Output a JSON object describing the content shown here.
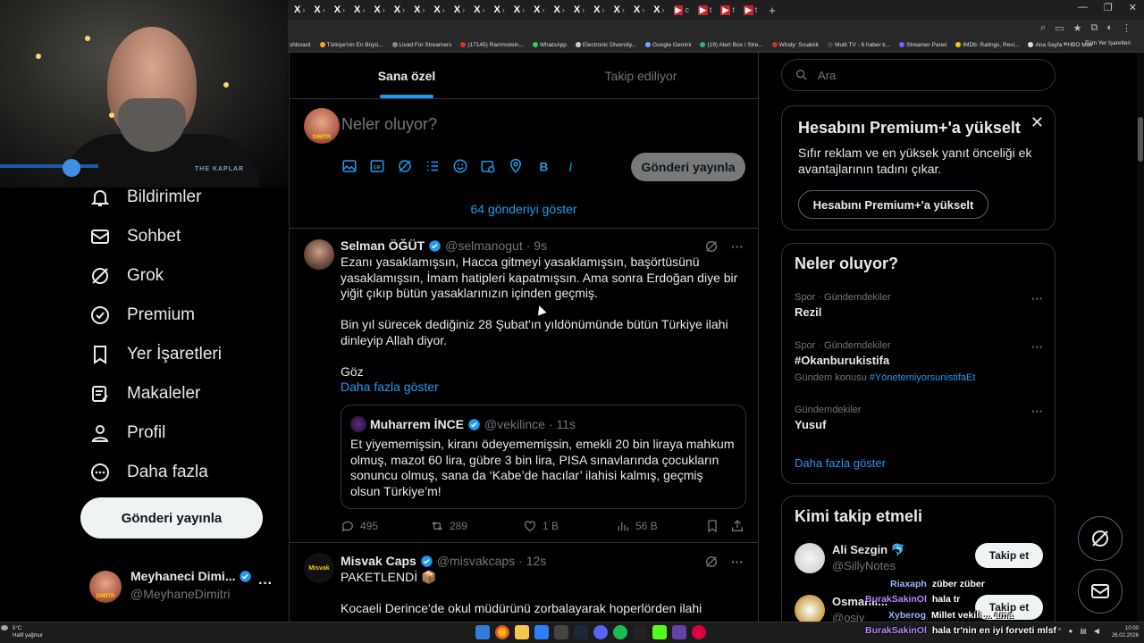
{
  "browser": {
    "tabs": [
      {
        "short": "X",
        "close": "›"
      },
      {
        "short": "X",
        "close": "›"
      },
      {
        "short": "X",
        "close": "›"
      },
      {
        "short": "X",
        "close": "›"
      },
      {
        "short": "X",
        "close": "›"
      },
      {
        "short": "X",
        "close": "›"
      },
      {
        "short": "X",
        "close": "›"
      },
      {
        "short": "X",
        "close": "›"
      },
      {
        "short": "X",
        "close": "›"
      },
      {
        "short": "X",
        "close": "›"
      },
      {
        "short": "X",
        "close": "›"
      },
      {
        "short": "X",
        "close": "›"
      },
      {
        "short": "X",
        "close": "›"
      },
      {
        "short": "X",
        "close": "›"
      },
      {
        "short": "X",
        "close": "›"
      },
      {
        "short": "X",
        "close": "›"
      },
      {
        "short": "X",
        "close": "›"
      },
      {
        "short": "X",
        "close": "›"
      },
      {
        "short": "X",
        "close": "›"
      },
      {
        "short": "▶",
        "close": "c",
        "red": true
      },
      {
        "short": "▶",
        "close": "t",
        "red": true
      },
      {
        "short": "▶",
        "close": "t",
        "red": true
      },
      {
        "short": "▶",
        "close": "t",
        "red": true
      }
    ],
    "new_tab": "+",
    "bookmarks": [
      {
        "label": "shboard",
        "color": ""
      },
      {
        "label": "Türkiye'nin En Büyü...",
        "color": "#f5a623"
      },
      {
        "label": "Livad For Streamers",
        "color": "#888"
      },
      {
        "label": "(17145) Rammstein...",
        "color": "#e52d27"
      },
      {
        "label": "WhatsApp",
        "color": "#25d366"
      },
      {
        "label": "Electronic Diversity...",
        "color": "#ccc"
      },
      {
        "label": "Google Gemini",
        "color": "#6ea8ff"
      },
      {
        "label": "(19) Alert Box / Stre...",
        "color": "#30b27a"
      },
      {
        "label": "Windy: Sıcaklık",
        "color": "#c33"
      },
      {
        "label": "Multi TV - 6 haber k...",
        "color": "#444"
      },
      {
        "label": "Streamer Panel",
        "color": "#7a5cff"
      },
      {
        "label": "IMDb: Ratings, Revi...",
        "color": "#f5c518"
      },
      {
        "label": "Ana Sayfa • HBO Max",
        "color": "#ddd"
      }
    ],
    "bookmarks_more": "»",
    "bookmarks_folder": "Tüm Yer İşaretleri"
  },
  "webcam": {
    "logo": "THE KAPLAR"
  },
  "nav": {
    "items": [
      {
        "label": "Bildirimler",
        "icon": "bell-icon"
      },
      {
        "label": "Sohbet",
        "icon": "mail-icon"
      },
      {
        "label": "Grok",
        "icon": "grok-icon"
      },
      {
        "label": "Premium",
        "icon": "premium-icon"
      },
      {
        "label": "Yer İşaretleri",
        "icon": "bookmark-icon"
      },
      {
        "label": "Makaleler",
        "icon": "article-icon"
      },
      {
        "label": "Profil",
        "icon": "profile-icon"
      },
      {
        "label": "Daha fazla",
        "icon": "more-circle-icon"
      }
    ],
    "post_button": "Gönderi yayınla",
    "account": {
      "name": "Meyhaneci Dimi...",
      "handle": "@MeyhaneDimitri",
      "avatar_text": "DIMITR",
      "more": "···"
    }
  },
  "main": {
    "tabs": [
      {
        "label": "Sana özel",
        "active": true
      },
      {
        "label": "Takip ediliyor",
        "active": false
      }
    ],
    "composer": {
      "placeholder": "Neler oluyor?",
      "post_button": "Gönderi yayınla"
    },
    "show_more": "64 gönderiyi göster",
    "tweets": [
      {
        "name": "Selman ÖĞÜT",
        "handle": "@selmanogut",
        "time": "· 9s",
        "body": "Ezanı yasaklamışsın, Hacca gitmeyi yasaklamışsın, başörtüsünü yasaklamışsın, İmam hatipleri kapatmışsın. Ama sonra Erdoğan diye bir yiğit çıkıp bütün yasaklarınızın içinden geçmiş.\n\nBin yıl sürecek dediğiniz 28 Şubat'ın yıldönümünde bütün Türkiye ilahi dinleyip Allah diyor.\n\nGöz",
        "show_more": "Daha fazla göster",
        "quote": {
          "name": "Muharrem İNCE",
          "handle": "@vekilince",
          "time": "· 11s",
          "body": "Et yiyememişsin, kiranı ödeyememişsin, emekli 20 bin liraya mahkum olmuş, mazot 60 lira, gübre 3 bin lira, PISA sınavlarında çocukların sonuncu olmuş, sana da  ‘Kabe’de hacılar’ ilahisi kalmış, geçmiş olsun Türkiye’m!"
        },
        "replies": "495",
        "retweets": "289",
        "likes": "1 B",
        "views": "56 B"
      },
      {
        "name": "Misvak Caps",
        "handle": "@misvakcaps",
        "time": "· 12s",
        "avatar_text": "Misvak",
        "body": "PAKETLENDİ 📦\n\nKocaeli Derince'de okul müdürünü zorbalayarak hoperlörden ilahi"
      }
    ]
  },
  "right": {
    "search_placeholder": "Ara",
    "premium": {
      "title": "Hesabını Premium+'a yükselt",
      "close": "✕",
      "text": "Sıfır reklam ve en yüksek yanıt önceliği ek avantajlarının tadını çıkar.",
      "button": "Hesabını Premium+'a yükselt"
    },
    "trends": {
      "title": "Neler oluyor?",
      "items": [
        {
          "meta": "Spor · Gündemdekiler",
          "name": "Rezil",
          "sub_label": "",
          "sub_tag": ""
        },
        {
          "meta": "Spor · Gündemdekiler",
          "name": "#Okanburukistifa",
          "sub_label": "Gündem konusu",
          "sub_tag": "#YönetemiyorsunistifaEt"
        },
        {
          "meta": "Gündemdekiler",
          "name": "Yusuf",
          "sub_label": "",
          "sub_tag": ""
        }
      ],
      "more_dots": "···",
      "show_more": "Daha fazla göster"
    },
    "who_to_follow": {
      "title": "Kimi takip etmeli",
      "items": [
        {
          "name": "Ali Sezgin 🐬",
          "handle": "@SillyNotes",
          "button": "Takip et"
        },
        {
          "name": "Osmanlı... ",
          "handle": "@osiv",
          "button": "Takip et"
        }
      ]
    }
  },
  "chat": [
    {
      "user": "Riaxaph",
      "msg": "züber züber",
      "purple": false
    },
    {
      "user": "BurakSakinOl",
      "msg": "hala tr",
      "purple": true
    },
    {
      "user": "Xyberog",
      "msg": "Millet vekili ... ama",
      "purple": false
    },
    {
      "user": "BurakSakinOl",
      "msg": "hala tr'nin en iyi forveti mlsf",
      "purple": true
    }
  ],
  "taskbar": {
    "weather_temp": "5°C",
    "weather_desc": "Hafif yağmur",
    "time": "10:00",
    "date": "26.02.2026"
  }
}
